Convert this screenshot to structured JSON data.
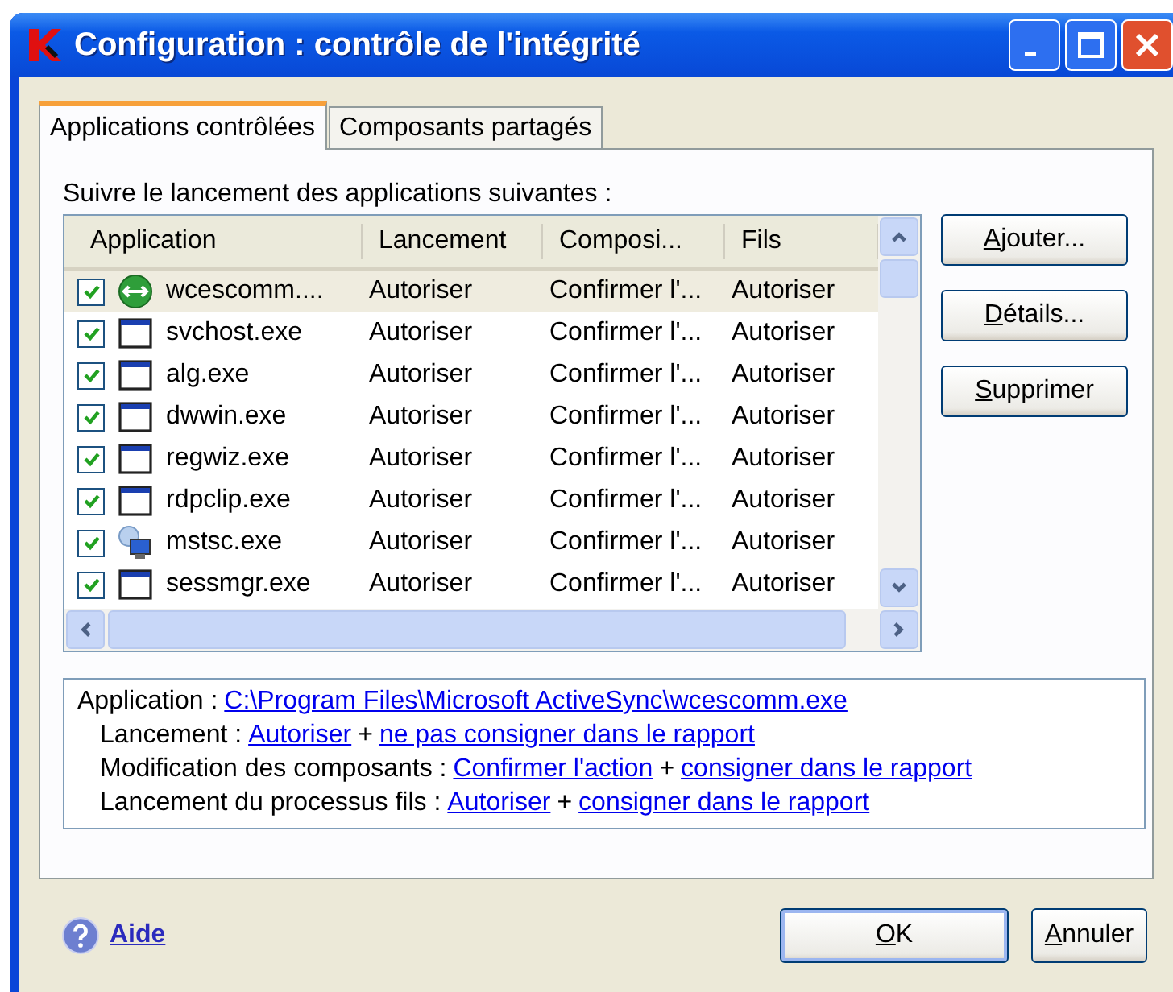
{
  "window": {
    "title": "Configuration : contrôle de l'intégrité"
  },
  "tabs": [
    {
      "label": "Applications contrôlées",
      "selected": true
    },
    {
      "label": "Composants partagés",
      "selected": false
    }
  ],
  "list_label": "Suivre le lancement des applications suivantes :",
  "table": {
    "columns": [
      "Application",
      "Lancement",
      "Composi...",
      "Fils"
    ],
    "rows": [
      {
        "kind": "sync",
        "checked": true,
        "selected": true,
        "cells": [
          "wcescomm....",
          "Autoriser",
          "Confirmer l'...",
          "Autoriser"
        ]
      },
      {
        "kind": "window",
        "checked": true,
        "selected": false,
        "cells": [
          "svchost.exe",
          "Autoriser",
          "Confirmer l'...",
          "Autoriser"
        ]
      },
      {
        "kind": "window",
        "checked": true,
        "selected": false,
        "cells": [
          "alg.exe",
          "Autoriser",
          "Confirmer l'...",
          "Autoriser"
        ]
      },
      {
        "kind": "window",
        "checked": true,
        "selected": false,
        "cells": [
          "dwwin.exe",
          "Autoriser",
          "Confirmer l'...",
          "Autoriser"
        ]
      },
      {
        "kind": "window",
        "checked": true,
        "selected": false,
        "cells": [
          "regwiz.exe",
          "Autoriser",
          "Confirmer l'...",
          "Autoriser"
        ]
      },
      {
        "kind": "window",
        "checked": true,
        "selected": false,
        "cells": [
          "rdpclip.exe",
          "Autoriser",
          "Confirmer l'...",
          "Autoriser"
        ]
      },
      {
        "kind": "remote",
        "checked": true,
        "selected": false,
        "cells": [
          "mstsc.exe",
          "Autoriser",
          "Confirmer l'...",
          "Autoriser"
        ]
      },
      {
        "kind": "window",
        "checked": true,
        "selected": false,
        "cells": [
          "sessmgr.exe",
          "Autoriser",
          "Confirmer l'...",
          "Autoriser"
        ]
      }
    ]
  },
  "side_buttons": [
    {
      "label": "Ajouter..."
    },
    {
      "label": "Détails..."
    },
    {
      "label": "Supprimer"
    }
  ],
  "details": [
    {
      "label": "Application :",
      "segments": [
        {
          "kind": "link",
          "text": "C:\\Program Files\\Microsoft ActiveSync\\wcescomm.exe"
        }
      ]
    },
    {
      "label": "Lancement :",
      "segments": [
        {
          "kind": "link",
          "text": "Autoriser"
        },
        {
          "kind": "plain",
          "text": "+"
        },
        {
          "kind": "link",
          "text": "ne pas consigner dans le rapport"
        }
      ]
    },
    {
      "label": "Modification des composants :",
      "segments": [
        {
          "kind": "link",
          "text": "Confirmer l'action"
        },
        {
          "kind": "plain",
          "text": "+"
        },
        {
          "kind": "link",
          "text": "consigner dans le rapport"
        }
      ]
    },
    {
      "label": "Lancement du processus fils :",
      "segments": [
        {
          "kind": "link",
          "text": "Autoriser"
        },
        {
          "kind": "plain",
          "text": "+"
        },
        {
          "kind": "link",
          "text": "consigner dans le rapport"
        }
      ]
    }
  ],
  "help_link": "Aide",
  "footer_buttons": [
    {
      "label": "OK",
      "default": true
    },
    {
      "label": "Annuler",
      "default": false
    }
  ]
}
